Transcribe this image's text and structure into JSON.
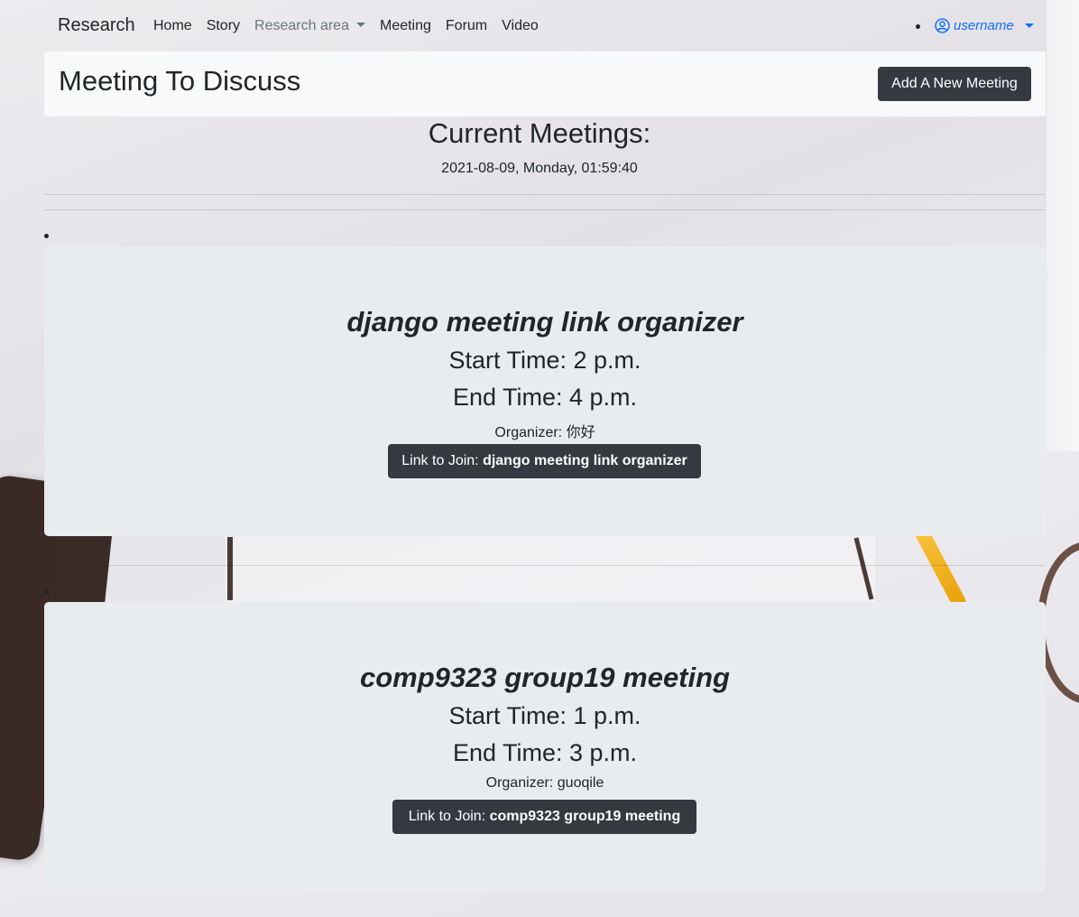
{
  "navbar": {
    "brand": "Research",
    "links": [
      {
        "label": "Home"
      },
      {
        "label": "Story"
      },
      {
        "label": "Research area"
      },
      {
        "label": "Meeting"
      },
      {
        "label": "Forum"
      },
      {
        "label": "Video"
      }
    ],
    "user": "username"
  },
  "header": {
    "title": "Meeting To Discuss",
    "add_button": "Add A New Meeting"
  },
  "main": {
    "section_title": "Current Meetings:",
    "datetime": "2021-08-09, Monday, 01:59:40",
    "meetings": [
      {
        "title": "django meeting link organizer",
        "start": "Start Time: 2 p.m.",
        "end": "End Time: 4 p.m.",
        "organizer": "Organizer: 你好",
        "join_prefix": "Link to Join: ",
        "join_name": "django meeting link organizer"
      },
      {
        "title": "comp9323 group19 meeting",
        "start": "Start Time: 1 p.m.",
        "end": "End Time: 3 p.m.",
        "organizer": "Organizer: guoqile",
        "join_prefix": "Link to Join: ",
        "join_name": "comp9323 group19 meeting"
      }
    ]
  },
  "colors": {
    "dark_button": "#343a40",
    "card_bg": "#e9ecef",
    "link_blue": "#0d6efd"
  }
}
